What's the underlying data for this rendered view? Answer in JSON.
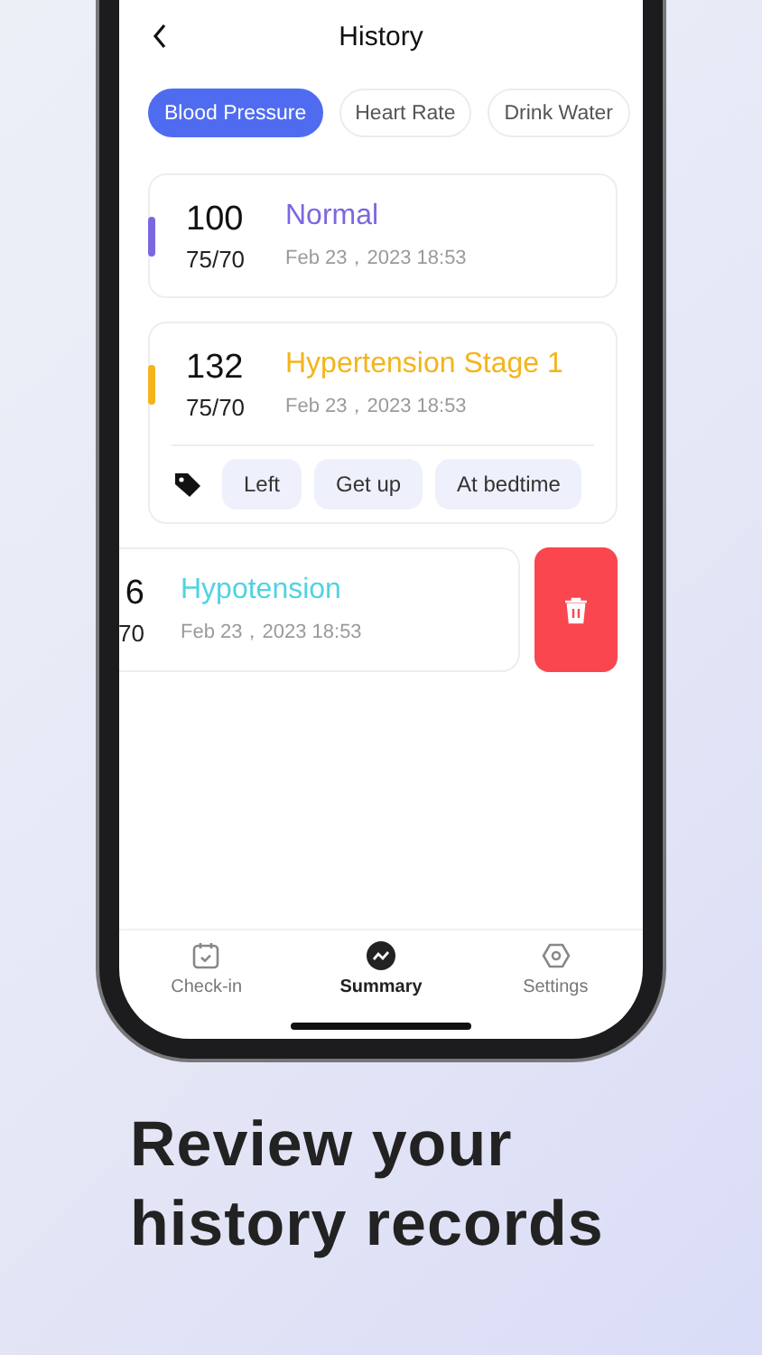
{
  "header": {
    "title": "History"
  },
  "tabs": [
    {
      "label": "Blood Pressure",
      "selected": true
    },
    {
      "label": "Heart Rate",
      "selected": false
    },
    {
      "label": "Drink Water",
      "selected": false
    }
  ],
  "records": [
    {
      "kind": "full",
      "systolic": "100",
      "diastolic": "75/70",
      "status": "Normal",
      "color": "#7a68e0",
      "time": "Feb 23，2023 18:53"
    },
    {
      "kind": "full",
      "systolic": "132",
      "diastolic": "75/70",
      "status": "Hypertension Stage 1",
      "color": "#f4b41a",
      "time": "Feb 23，2023 18:53",
      "tags": [
        "Left",
        "Get up",
        "At bedtime"
      ]
    },
    {
      "kind": "swiped",
      "systolic": "6",
      "diastolic": "70",
      "status": "Hypotension",
      "color": "#4fd3e3",
      "time": "Feb 23，2023 18:53"
    }
  ],
  "nav": [
    {
      "label": "Check-in",
      "selected": false
    },
    {
      "label": "Summary",
      "selected": true
    },
    {
      "label": "Settings",
      "selected": false
    }
  ],
  "caption": [
    "Review your",
    "history records"
  ]
}
